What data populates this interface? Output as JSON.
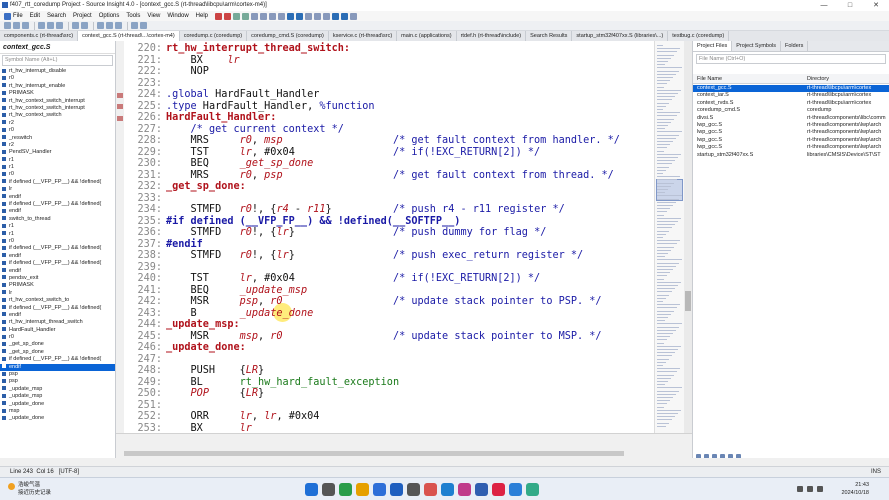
{
  "window": {
    "title": "f407_rtt_coredump Project - Source Insight 4.0 - [context_gcc.S (rt-thread\\libcpu\\arm\\cortex-m4)]"
  },
  "menu": [
    "File",
    "Edit",
    "Search",
    "Project",
    "Options",
    "Tools",
    "View",
    "Window",
    "Help"
  ],
  "tabs": [
    {
      "label": "components.c (rt-thread\\src)",
      "active": false
    },
    {
      "label": "context_gcc.S (rt-thread\\...\\cortex-m4)",
      "active": true
    },
    {
      "label": "coredump.c (coredump)",
      "active": false
    },
    {
      "label": "coredump_cmd.S (coredump)",
      "active": false
    },
    {
      "label": "kservice.c (rt-thread\\src)",
      "active": false
    },
    {
      "label": "main.c (applications)",
      "active": false
    },
    {
      "label": "rtdef.h (rt-thread\\include)",
      "active": false
    },
    {
      "label": "Search Results",
      "active": false
    },
    {
      "label": "startup_stm32f407xx.S (libraries\\...)",
      "active": false
    },
    {
      "label": "testbug.c (coredump)",
      "active": false
    }
  ],
  "symbol_panel": {
    "file_name": "context_gcc.S",
    "search_placeholder": "Symbol Name (Alt+L)",
    "symbols": [
      "rt_hw_interrupt_disable",
      "r0",
      "rt_hw_interrupt_enable",
      "PRIMASK",
      "rt_hw_context_switch_interrupt",
      "rt_hw_context_switch_interrupt",
      "rt_hw_context_switch",
      "r2",
      "r0",
      "_reswitch",
      "r2",
      "PendSV_Handler",
      "r1",
      "r1",
      "r0",
      "if defined (__VFP_FP__) && !defined(",
      "lr",
      "endif",
      "if defined (__VFP_FP__) && !defined(",
      "endif",
      "switch_to_thread",
      "r1",
      "r1",
      "r0",
      "if defined (__VFP_FP__) && !defined(",
      "endif",
      "if defined (__VFP_FP__) && !defined(",
      "endif",
      "pendsv_exit",
      "PRIMASK",
      "lr",
      "rt_hw_context_switch_to",
      "if defined (__VFP_FP__) && !defined(",
      "endif",
      "rt_hw_interrupt_thread_switch",
      "HardFault_Handler",
      "r0",
      "_get_sp_done",
      "_get_sp_done",
      "if defined (__VFP_FP__) && !defined(",
      "endif",
      "psp",
      "psp",
      "_update_msp",
      "_update_msp",
      "_update_done",
      "msp",
      "_update_done"
    ],
    "selected_index": 40
  },
  "editor": {
    "lines": [
      {
        "n": "220:",
        "t": "label",
        "s": "rt_hw_interrupt_thread_switch:"
      },
      {
        "n": "221:",
        "t": "code",
        "s": "    BX    lr"
      },
      {
        "n": "222:",
        "t": "code",
        "s": "    NOP"
      },
      {
        "n": "223:",
        "t": "code",
        "s": ""
      },
      {
        "n": "224:",
        "t": "code",
        "s": ".global HardFault_Handler"
      },
      {
        "n": "225:",
        "t": "code",
        "s": ".type HardFault_Handler, %function"
      },
      {
        "n": "226:",
        "t": "label",
        "s": "HardFault_Handler:"
      },
      {
        "n": "227:",
        "t": "code",
        "s": "    /* get current context */"
      },
      {
        "n": "228:",
        "t": "code",
        "s": "    MRS     r0, msp                  /* get fault context from handler. */"
      },
      {
        "n": "229:",
        "t": "code",
        "s": "    TST     lr, #0x04                /* if(!EXC_RETURN[2]) */"
      },
      {
        "n": "230:",
        "t": "code",
        "s": "    BEQ     _get_sp_done"
      },
      {
        "n": "231:",
        "t": "code",
        "s": "    MRS     r0, psp                  /* get fault context from thread. */"
      },
      {
        "n": "232:",
        "t": "label",
        "s": "_get_sp_done:"
      },
      {
        "n": "233:",
        "t": "code",
        "s": ""
      },
      {
        "n": "234:",
        "t": "code",
        "s": "    STMFD   r0!, {r4 - r11}          /* push r4 - r11 register */"
      },
      {
        "n": "235:",
        "t": "code",
        "s": "#if defined (__VFP_FP__) && !defined(__SOFTFP__)"
      },
      {
        "n": "236:",
        "t": "code",
        "s": "    STMFD   r0!, {lr}                /* push dummy for flag */"
      },
      {
        "n": "237:",
        "t": "code",
        "s": "#endif"
      },
      {
        "n": "238:",
        "t": "code",
        "s": "    STMFD   r0!, {lr}                /* push exec_return register */"
      },
      {
        "n": "239:",
        "t": "code",
        "s": ""
      },
      {
        "n": "240:",
        "t": "code",
        "s": "    TST     lr, #0x04                /* if(!EXC_RETURN[2]) */"
      },
      {
        "n": "241:",
        "t": "code",
        "s": "    BEQ     _update_msp"
      },
      {
        "n": "242:",
        "t": "code",
        "s": "    MSR     psp, r0                  /* update stack pointer to PSP. */"
      },
      {
        "n": "243:",
        "t": "code",
        "s": "    B       _update_done"
      },
      {
        "n": "244:",
        "t": "label",
        "s": "_update_msp:"
      },
      {
        "n": "245:",
        "t": "code",
        "s": "    MSR     msp, r0                  /* update stack pointer to MSP. */"
      },
      {
        "n": "246:",
        "t": "label",
        "s": "_update_done:"
      },
      {
        "n": "247:",
        "t": "code",
        "s": ""
      },
      {
        "n": "248:",
        "t": "code",
        "s": "    PUSH    {LR}"
      },
      {
        "n": "249:",
        "t": "code",
        "s": "    BL      rt_hw_hard_fault_exception"
      },
      {
        "n": "250:",
        "t": "code",
        "s": "    POP     {LR}"
      },
      {
        "n": "251:",
        "t": "code",
        "s": ""
      },
      {
        "n": "252:",
        "t": "code",
        "s": "    ORR     lr, lr, #0x04"
      },
      {
        "n": "253:",
        "t": "code",
        "s": "    BX      lr"
      }
    ]
  },
  "project_panel": {
    "tabs": [
      "Project Files",
      "Project Symbols",
      "Folders"
    ],
    "search_placeholder": "File Name (Ctrl+O)",
    "col_file": "File Name",
    "col_dir": "Directory",
    "files": [
      {
        "f": "context_gcc.S",
        "d": "rt-thread\\libcpu\\arm\\cortex",
        "sel": true
      },
      {
        "f": "context_iar.S",
        "d": "rt-thread\\libcpu\\arm\\cortex",
        "sel": false
      },
      {
        "f": "context_rvds.S",
        "d": "rt-thread\\libcpu\\arm\\cortex",
        "sel": false
      },
      {
        "f": "coredump_cmd.S",
        "d": "coredump",
        "sel": false
      },
      {
        "f": "divsi.S",
        "d": "rt-thread\\components\\libc\\comm",
        "sel": false
      },
      {
        "f": "lwp_gcc.S",
        "d": "rt-thread\\components\\lwp\\arch",
        "sel": false
      },
      {
        "f": "lwp_gcc.S",
        "d": "rt-thread\\components\\lwp\\arch",
        "sel": false
      },
      {
        "f": "lwp_gcc.S",
        "d": "rt-thread\\components\\lwp\\arch",
        "sel": false
      },
      {
        "f": "lwp_gcc.S",
        "d": "rt-thread\\components\\lwp\\arch",
        "sel": false
      },
      {
        "f": "startup_stm32f407xx.S",
        "d": "libraries\\CMSIS\\Device\\ST\\ST",
        "sel": false
      }
    ]
  },
  "status": {
    "position": "Line 243  Col 16   [UTF-8]",
    "mode": "INS"
  },
  "taskbar": {
    "weather_line1": "浩峻气温",
    "weather_line2": "接近历史记录",
    "time": "21:43",
    "date": "2024/10/18"
  },
  "colors": {
    "selection": "#0a64d6",
    "label": "#b0121b",
    "comment": "#1a1aa6",
    "function_call": "#1a7a1a"
  }
}
